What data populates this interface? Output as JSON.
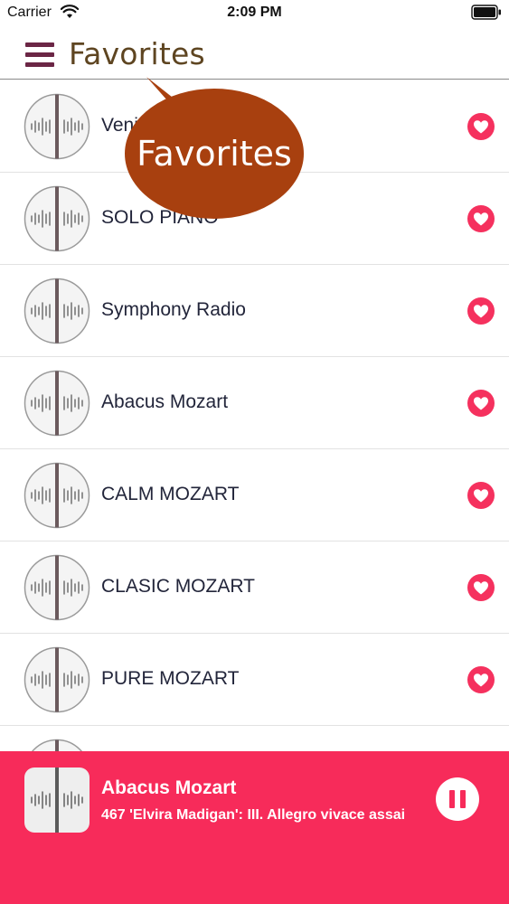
{
  "status_bar": {
    "carrier": "Carrier",
    "time": "2:09 PM"
  },
  "header": {
    "title": "Favorites",
    "menu_icon": "hamburger-menu-icon",
    "accent_color": "#6b2645"
  },
  "tooltip": {
    "text": "Favorites",
    "color": "#a8400f"
  },
  "stations": [
    {
      "name": "Venice Classic Radio",
      "favorite": true
    },
    {
      "name": "SOLO PIANO",
      "favorite": true
    },
    {
      "name": "Symphony Radio",
      "favorite": true
    },
    {
      "name": "Abacus Mozart",
      "favorite": true
    },
    {
      "name": "CALM MOZART",
      "favorite": true
    },
    {
      "name": "CLASIC MOZART",
      "favorite": true
    },
    {
      "name": "PURE MOZART",
      "favorite": true
    },
    {
      "name": "",
      "favorite": true
    }
  ],
  "now_playing": {
    "station": "Abacus Mozart",
    "track": "467 'Elvira Madigan': III. Allegro vivace assai",
    "state": "playing",
    "control_icon": "pause-icon",
    "background_color": "#f72b5a"
  }
}
